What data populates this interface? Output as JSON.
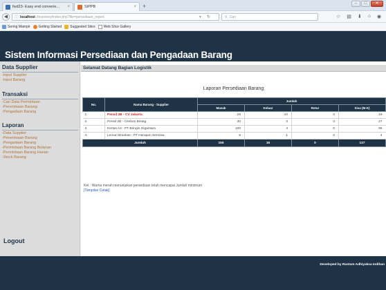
{
  "browser": {
    "tabs": [
      {
        "label": "fwd23- Easy end converie...",
        "close": "×"
      },
      {
        "label": "SIPPB",
        "close": "×"
      }
    ],
    "new_tab": "+",
    "url_host": "localhost",
    "url_path": "/inventory/index.php?file=persediaan_report",
    "search_engine": "Cari",
    "bookmarks": [
      "Sering Mampir",
      "Getting Started",
      "Suggested Sites",
      "Web Slice Gallery"
    ]
  },
  "app": {
    "title": "Sistem Informasi Persediaan dan Pengadaan Barang"
  },
  "sidebar": {
    "sections": [
      {
        "title": "Data Supplier",
        "links": [
          "-Input Supplier",
          "-Input Barang"
        ]
      },
      {
        "title": "Transaksi",
        "links": [
          "-Cari Data Permintaan",
          "-Penerimaan Barang",
          "-Pengadaan Barang"
        ]
      },
      {
        "title": "Laporan",
        "links": [
          "-Data Supplier",
          "-Penerimaan Barang",
          "-Pengadaan Barang",
          "-Permintaan Barang Bulanan",
          "-Permintaan Barang Harian",
          "-Stock Barang"
        ]
      }
    ],
    "logout": "Logout"
  },
  "content": {
    "welcome": "Selamat Datang Bagian Logistik",
    "report_title": "Laporan Persediaan Barang",
    "table": {
      "headers": {
        "no": "No.",
        "name": "Nama Barang - Supplier",
        "jumlah": "Jumlah",
        "masuk": "Masuk",
        "keluar": "Keluar",
        "retur": "Retur",
        "sisa": "Sisa (M-K)"
      },
      "rows": [
        {
          "no": "1.",
          "name": "Pensil 2B - CV Jakarta",
          "masuk": "29",
          "keluar": "10",
          "retur": "0",
          "sisa": "19",
          "low": true
        },
        {
          "no": "2.",
          "name": "Pensil 2B - Cirebon Bintag",
          "masuk": "30",
          "keluar": "3",
          "retur": "0",
          "sisa": "27",
          "low": false
        },
        {
          "no": "3.",
          "name": "Kertas A4 - PT Bringin Gigantara",
          "masuk": "100",
          "keluar": "4",
          "retur": "0",
          "sisa": "96",
          "low": false
        },
        {
          "no": "4.",
          "name": "Lemari Brankas - PT Harapan Sentosa",
          "masuk": "5",
          "keluar": "1",
          "retur": "0",
          "sisa": "4",
          "low": false
        }
      ],
      "total": {
        "label": "Jumlah",
        "masuk": "155",
        "keluar": "16",
        "retur": "0",
        "sisa": "137"
      }
    },
    "note": "Ket : Warna merah menunjukan persediaan telah mencapai Jumlah minimum",
    "print_link": "[Tampilan Cetak]"
  },
  "footer": {
    "credit": "Developed by Rustam Adhiyaksa Indihan"
  },
  "colors": {
    "header_bg": "#1f3346",
    "sidebar_bg": "#dcdcdc",
    "link": "#b0733a",
    "low_stock": "#d11a1a"
  }
}
